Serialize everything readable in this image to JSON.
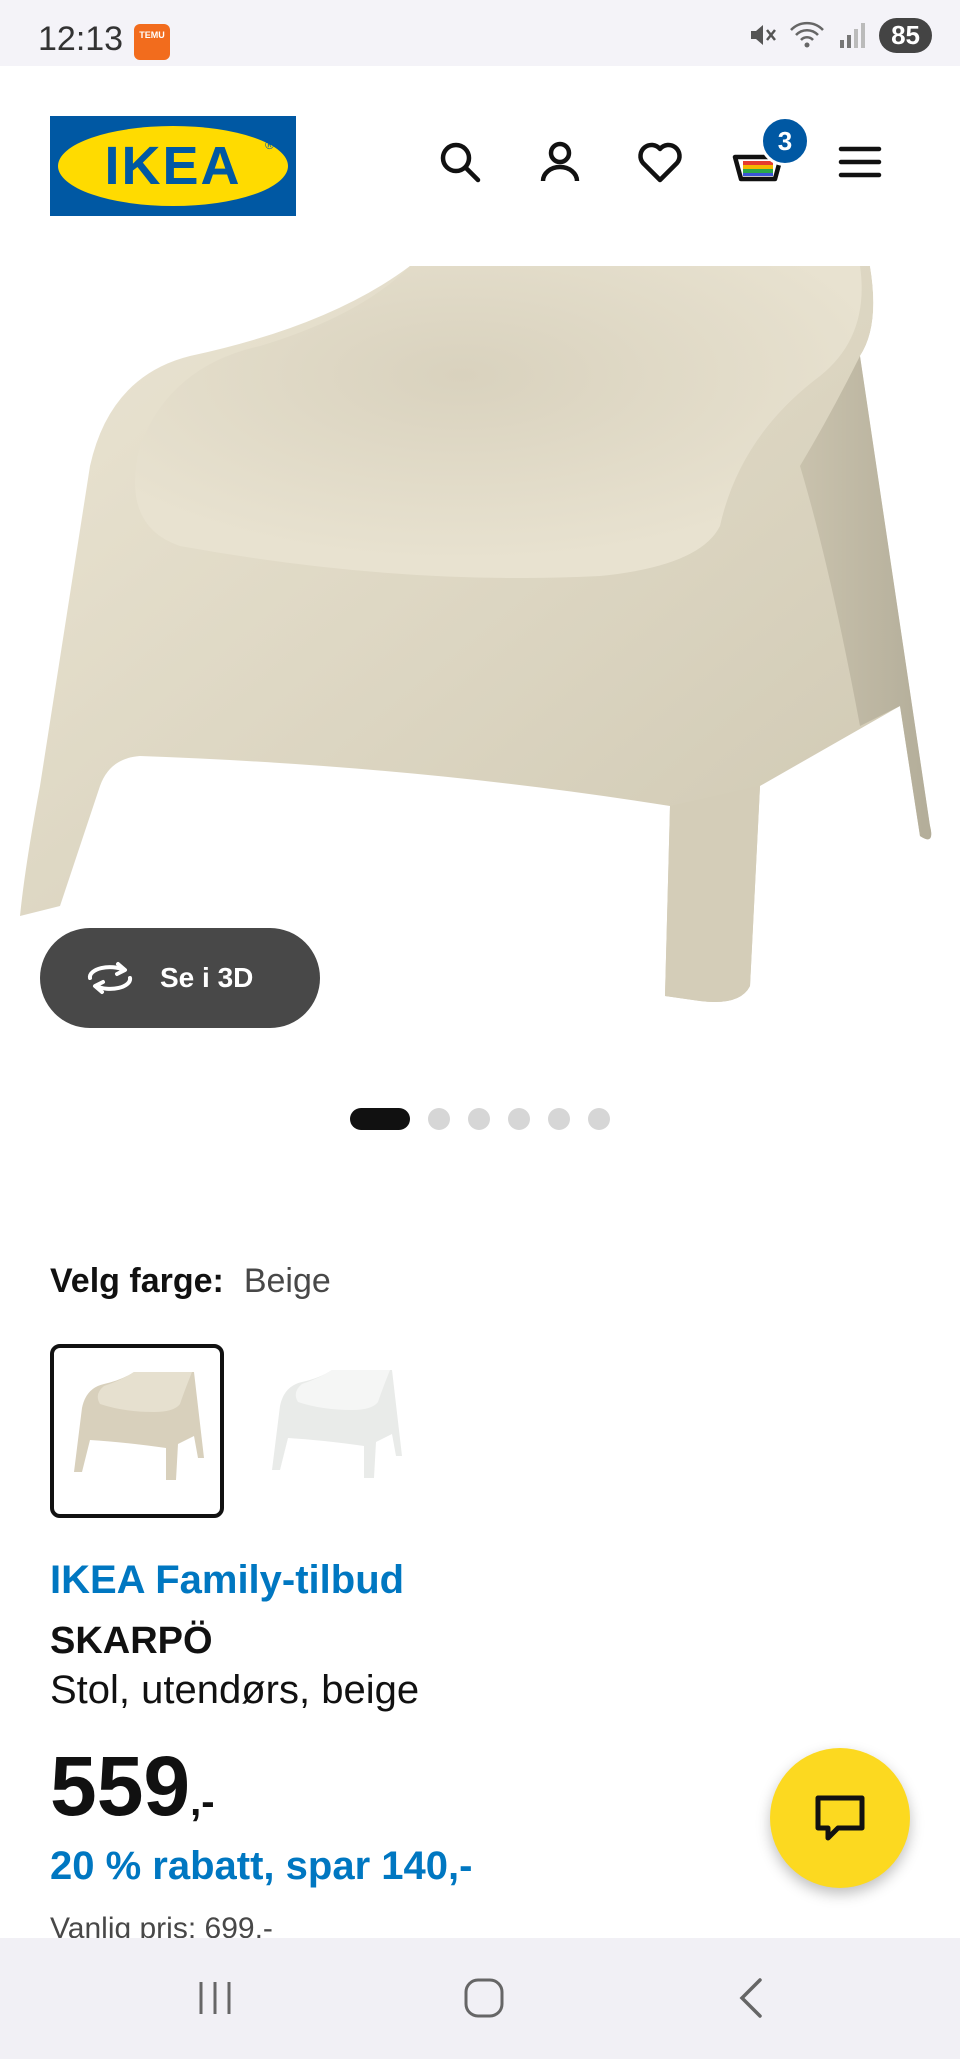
{
  "status_bar": {
    "time": "12:13",
    "temu_label": "TEMU",
    "battery": "85"
  },
  "header": {
    "logo_text": "IKEA",
    "cart_count": "3"
  },
  "gallery": {
    "view_3d_label": "Se i 3D",
    "dot_count": 6,
    "active_dot": 0
  },
  "color": {
    "label": "Velg farge:",
    "value": "Beige",
    "options": [
      "Beige",
      "Hvit"
    ]
  },
  "product": {
    "offer": "IKEA Family-tilbud",
    "name": "SKARPÖ",
    "description": "Stol, utendørs, beige",
    "price": "559",
    "price_suffix": ",-",
    "discount": "20 % rabatt, spar 140,-",
    "regular_price": "Vanlig pris: 699,-"
  },
  "colors": {
    "ikea_blue": "#0058a3",
    "ikea_yellow": "#ffdb00",
    "link_blue": "#0077c1",
    "chat_yellow": "#fcd920"
  }
}
